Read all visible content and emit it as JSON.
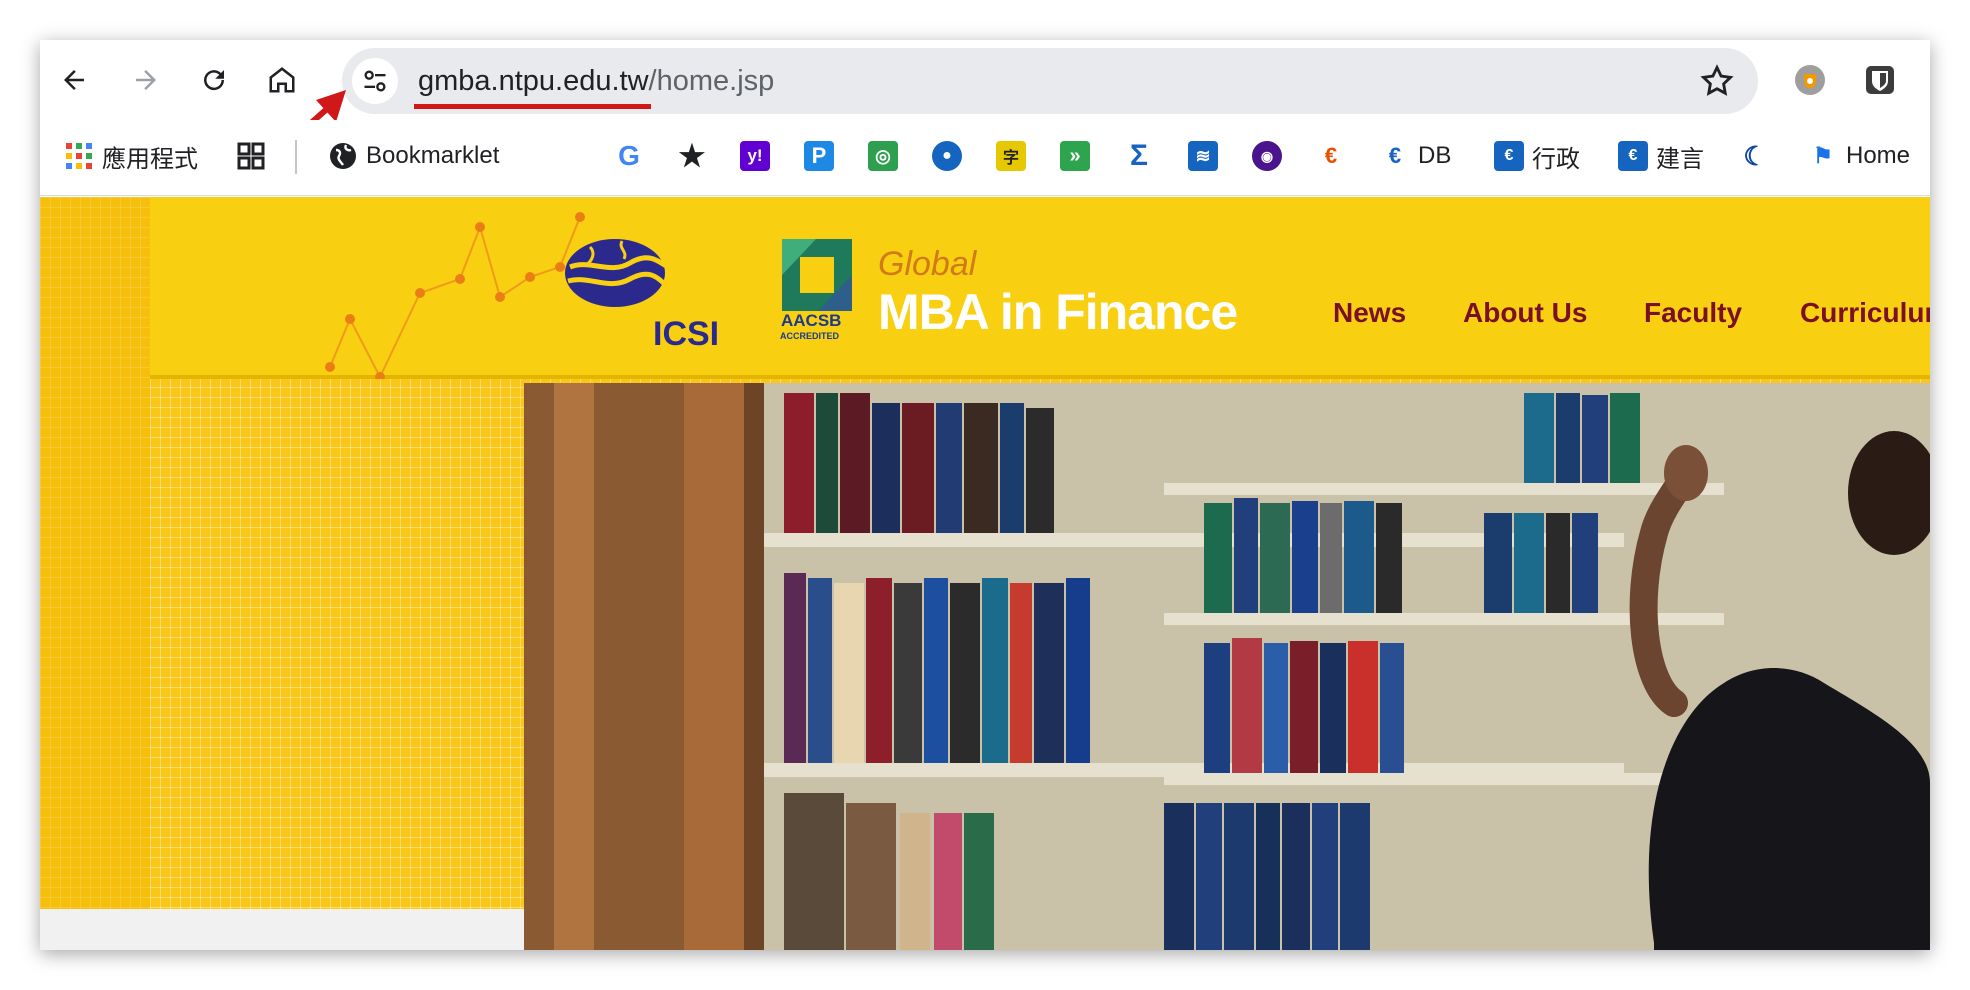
{
  "browser": {
    "url_host": "gmba.ntpu.edu.tw",
    "url_path": "/home.jsp"
  },
  "bookmarks": {
    "apps_label": "應用程式",
    "bookmarklet_label": "Bookmarklet",
    "db_label": "DB",
    "admin_label": "行政",
    "suggest_label": "建言",
    "home_label": "Home"
  },
  "site": {
    "brand_small": "Global",
    "brand_title": "MBA in Finance",
    "icsi_logo_text": "ICSI",
    "aacsb_logo_text": "AACSB",
    "aacsb_logo_sub": "ACCREDITED",
    "nav": [
      "News",
      "About Us",
      "Faculty",
      "Curriculum"
    ]
  },
  "colors": {
    "header_yellow": "#f9cf12",
    "nav_text": "#7a1026",
    "annotation_red": "#d01818"
  }
}
